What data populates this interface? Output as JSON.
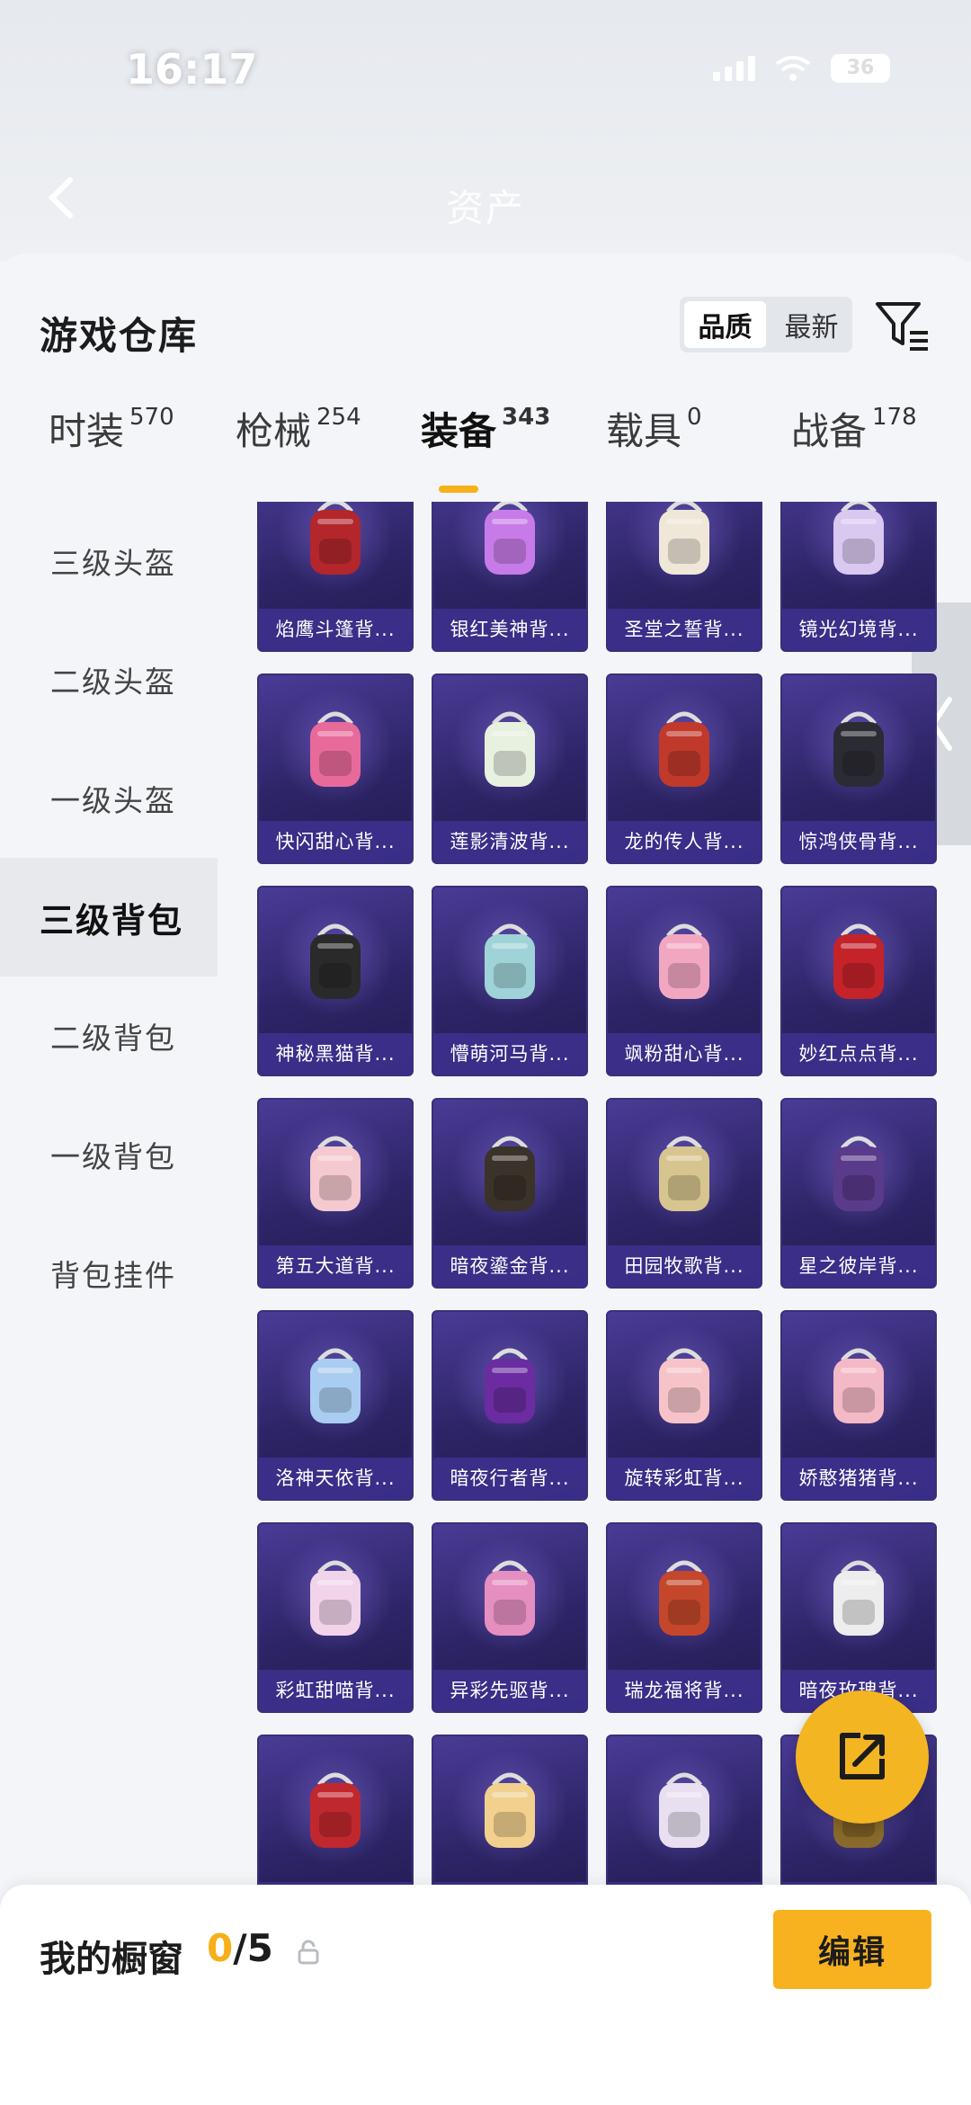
{
  "status": {
    "time": "16:17",
    "battery": "36"
  },
  "nav": {
    "title": "资产"
  },
  "sheet": {
    "title": "游戏仓库"
  },
  "sort": {
    "quality": "品质",
    "newest": "最新"
  },
  "tabs": [
    {
      "label": "时装",
      "count": "570"
    },
    {
      "label": "枪械",
      "count": "254"
    },
    {
      "label": "装备",
      "count": "343"
    },
    {
      "label": "载具",
      "count": "0"
    },
    {
      "label": "战备",
      "count": "178"
    }
  ],
  "sidebar": [
    {
      "label": "三级头盔"
    },
    {
      "label": "二级头盔"
    },
    {
      "label": "一级头盔"
    },
    {
      "label": "三级背包"
    },
    {
      "label": "二级背包"
    },
    {
      "label": "一级背包"
    },
    {
      "label": "背包挂件"
    }
  ],
  "items": [
    {
      "label": "焰鹰斗篷背...",
      "color": "#b3262c"
    },
    {
      "label": "银红美神背...",
      "color": "#c77be8"
    },
    {
      "label": "圣堂之誓背...",
      "color": "#efe7d8"
    },
    {
      "label": "镜光幻境背...",
      "color": "#d9c8ef"
    },
    {
      "label": "快闪甜心背...",
      "color": "#e86a9a"
    },
    {
      "label": "莲影清波背...",
      "color": "#e8f0e0"
    },
    {
      "label": "龙的传人背...",
      "color": "#c0392b"
    },
    {
      "label": "惊鸿侠骨背...",
      "color": "#2b2b33"
    },
    {
      "label": "神秘黑猫背...",
      "color": "#2a2a2a"
    },
    {
      "label": "懵萌河马背...",
      "color": "#9fd3d8"
    },
    {
      "label": "飒粉甜心背...",
      "color": "#f2a7c1"
    },
    {
      "label": "妙红点点背...",
      "color": "#c4232a"
    },
    {
      "label": "第五大道背...",
      "color": "#f4c9cf"
    },
    {
      "label": "暗夜鎏金背...",
      "color": "#3a332a"
    },
    {
      "label": "田园牧歌背...",
      "color": "#d7c58f"
    },
    {
      "label": "星之彼岸背...",
      "color": "#5a3a8a"
    },
    {
      "label": "洛神天依背...",
      "color": "#a9cdf0"
    },
    {
      "label": "暗夜行者背...",
      "color": "#6a2ca0"
    },
    {
      "label": "旋转彩虹背...",
      "color": "#f6c4c8"
    },
    {
      "label": "娇憨猪猪背...",
      "color": "#f4b9c6"
    },
    {
      "label": "彩虹甜喵背...",
      "color": "#f2d4ea"
    },
    {
      "label": "异彩先驱背...",
      "color": "#e58fc1"
    },
    {
      "label": "瑞龙福将背...",
      "color": "#c4472b"
    },
    {
      "label": "暗夜玫瑰背...",
      "color": "#ededed"
    },
    {
      "label": "",
      "color": "#c0282e"
    },
    {
      "label": "",
      "color": "#f2d08e"
    },
    {
      "label": "",
      "color": "#e8e0f0"
    },
    {
      "label": "",
      "color": "#8a6a2a"
    }
  ],
  "showcase": {
    "title": "我的橱窗",
    "current": "0",
    "total": "/5",
    "edit": "编辑"
  }
}
